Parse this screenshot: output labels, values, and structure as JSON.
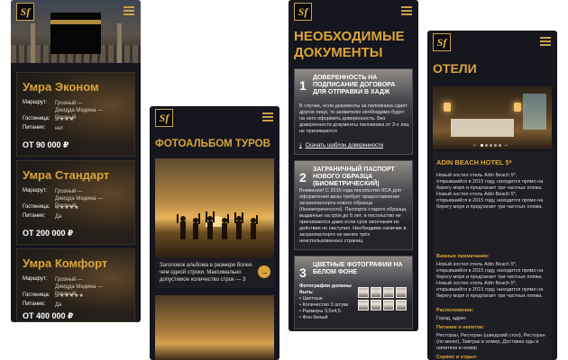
{
  "brand": {
    "logo_glyph": "Sf",
    "accent": "#d9a53a",
    "background": "#16161e"
  },
  "screen1": {
    "tours": [
      {
        "title": "Умра Эконом",
        "route_label": "Маршрут:",
        "route": "Грозный — Джидда Медина — Грозный",
        "hotel_label": "Гостиница:",
        "hotel_stars": "3 ★★★",
        "food_label": "Питание:",
        "food": "нет",
        "price": "ОТ 90 000 ₽"
      },
      {
        "title": "Умра Стандарт",
        "route_label": "Маршрут:",
        "route": "Грозный — Джидда Медина — Грозный",
        "hotel_label": "Гостиница:",
        "hotel_stars": "4 ★★★★",
        "food_label": "Питание:",
        "food": "Да",
        "price": "ОТ 200 000 ₽"
      },
      {
        "title": "Умра Комфорт",
        "route_label": "Маршрут:",
        "route": "Грозный — Джидда Медина — Грозный",
        "hotel_label": "Гостиница:",
        "hotel_stars": "5 ★★★★★",
        "food_label": "Питание:",
        "food": "Да",
        "price": "ОТ 400 000 ₽"
      }
    ]
  },
  "screen2": {
    "title": "Фотоальбом туров",
    "album_caption": "Заголовок альбома в размере более чем одной строки. Максимально допустимое количество строк — 3",
    "arrow_icon": "→"
  },
  "screen3": {
    "title_line1": "Необходимые",
    "title_line2": "документы",
    "docs": [
      {
        "num": "1",
        "title": "Доверенность на подписание договора для отправки в хадж",
        "body": "В случае, если документы за паломника сдаёт другое лицо, то заявителю необходимо будет на него оформить доверенность. Без доверенности документы паломника от 3-х лиц не принимаются",
        "link": "Скачать шаблон доверенности",
        "link_icon": "⤓"
      },
      {
        "num": "2",
        "title": "Заграничный паспорт нового образца (биометрический)",
        "body": "Внимание! С 2016 года посольство КСА для оформления визы требует предоставление загранпаспорта нового образца (биометрического). Паспорта старого образца, выданные на срок до 5 лет, в посольство не принимаются даже если срок окончания их действия не наступил. Необходимо наличие в загранпаспорте не менее трёх неиспользованных страниц"
      },
      {
        "num": "3",
        "title": "Цветные фотографии на белом фоне",
        "list_head": "Фотографии должны быть:",
        "list": [
          "• Цветные",
          "• Количество 3 штуки",
          "• Размеры 3,5x4,5",
          "• Фон белый"
        ]
      }
    ]
  },
  "screen4": {
    "title": "Отели",
    "hotel_name": "Adin Beach Hotel 5*",
    "desc1": "Новый хостел отель Adin Beach 5*, открывшийся в 2015 году, находится прямо на берегу моря и предлагает три частных пляжа. Новый хостел отель Adin Beach 5*, открывшийся в 2015 году, находится прямо на берегу моря и предлагает три частных пляжа.",
    "note_label": "Важные примечания:",
    "desc2": "Новый хостел отель Adin Beach 5*, открывшийся в 2015 году, находится прямо на берегу моря и предлагает три частных пляжа. Новый хостел отель Adin Beach 5*, открывшийся в 2015 году, находится прямо на берегу моря и предлагает три частных пляжа.",
    "location_label": "Расположение:",
    "location": "Город, адрес",
    "food_label": "Питание и напитки:",
    "food": "Ресторан, Ресторан (шведский стол), Ресторан (по меню), Завтрак в номер, Доставка еды и напитков в номер",
    "services_label": "Сервис и отдых:",
    "prev_icon": "←",
    "next_icon": "→"
  }
}
